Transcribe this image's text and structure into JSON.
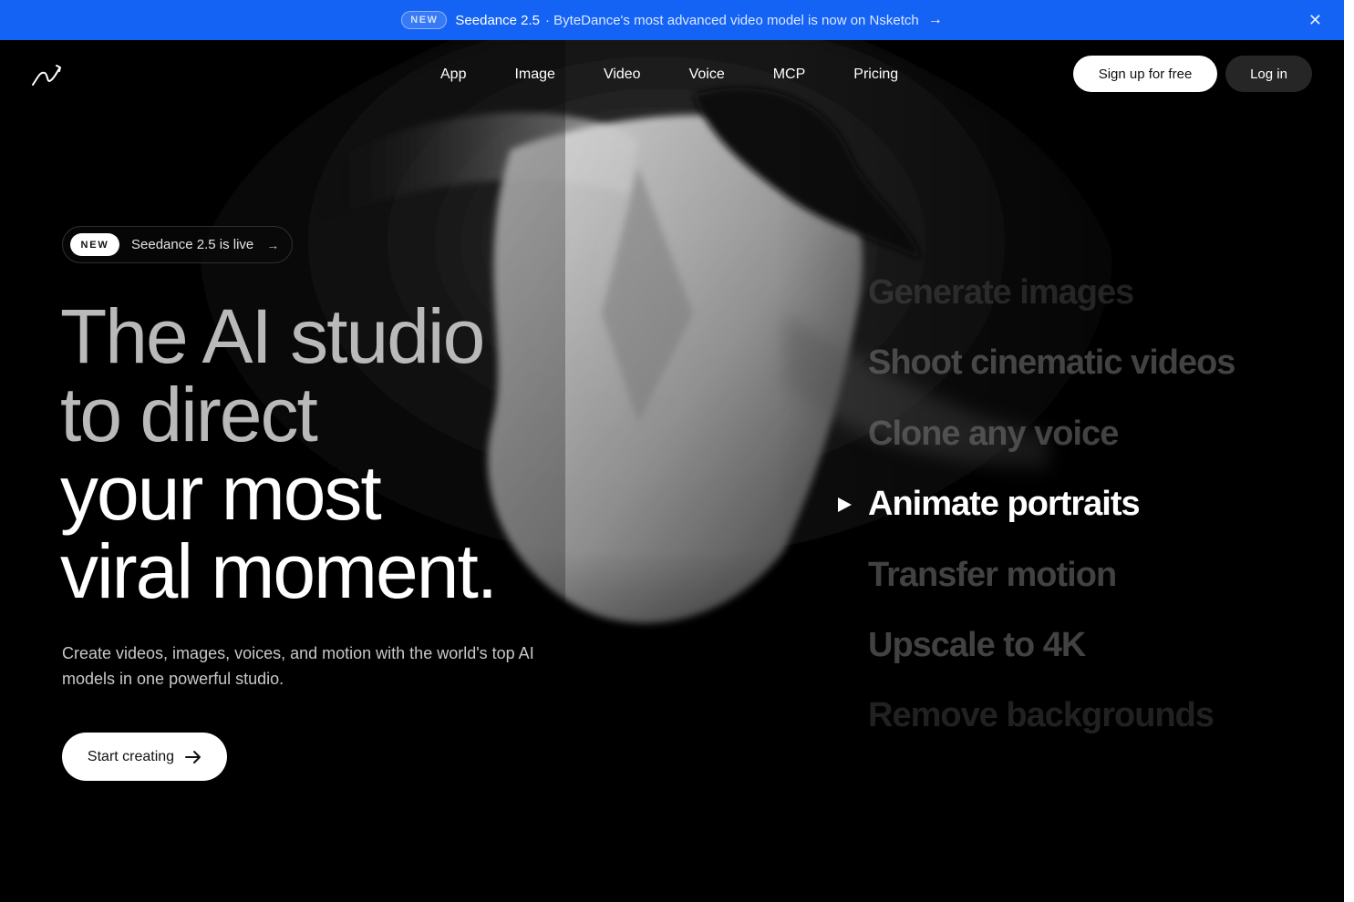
{
  "announcement": {
    "badge": "NEW",
    "model": "Seedance 2.5",
    "message": "· ByteDance's most advanced video model is now on Nsketch",
    "arrow": "→",
    "close": "✕"
  },
  "nav": {
    "logo_icon": "nsketch-logo-icon",
    "links": [
      "App",
      "Image",
      "Video",
      "Voice",
      "MCP",
      "Pricing"
    ],
    "signup_label": "Sign up for free",
    "login_label": "Log in"
  },
  "hero": {
    "badge_tag": "NEW",
    "badge_text": "Seedance 2.5 is live",
    "badge_arrow": "→",
    "headline_lines": [
      "The AI studio",
      "to direct",
      "your most",
      "viral moment."
    ],
    "subtitle": "Create videos, images, voices, and motion with the world's top AI models in one powerful studio.",
    "cta_label": "Start creating",
    "cta_icon": "arrow-right-icon"
  },
  "features": {
    "items": [
      "Generate images",
      "Shoot cinematic videos",
      "Clone any voice",
      "Animate portraits",
      "Transfer motion",
      "Upscale to 4K",
      "Remove backgrounds"
    ],
    "active": "Animate portraits",
    "active_icon": "play-icon"
  },
  "colors": {
    "announcement_bg": "#1463f5",
    "page_bg": "#000000",
    "button_light": "#ffffff",
    "button_dark": "#262626"
  }
}
